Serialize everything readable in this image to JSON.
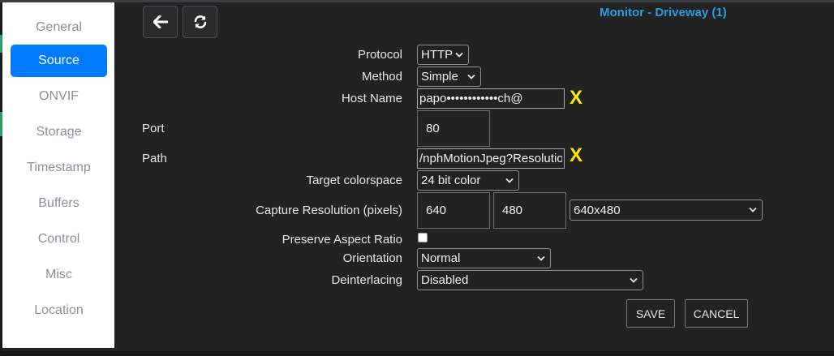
{
  "sidebar": {
    "items": [
      {
        "label": "General",
        "active": false
      },
      {
        "label": "Source",
        "active": true
      },
      {
        "label": "ONVIF",
        "active": false
      },
      {
        "label": "Storage",
        "active": false
      },
      {
        "label": "Timestamp",
        "active": false
      },
      {
        "label": "Buffers",
        "active": false
      },
      {
        "label": "Control",
        "active": false
      },
      {
        "label": "Misc",
        "active": false
      },
      {
        "label": "Location",
        "active": false
      }
    ]
  },
  "toolbar": {
    "back_icon": "arrow-left-icon",
    "refresh_icon": "refresh-icon"
  },
  "header": {
    "title": "Monitor - Driveway (1)"
  },
  "form": {
    "protocol": {
      "label": "Protocol",
      "value": "HTTP"
    },
    "method": {
      "label": "Method",
      "value": "Simple"
    },
    "host_name": {
      "label": "Host Name",
      "value": "papo••••••••••••ch@",
      "marker": "X"
    },
    "port": {
      "label": "Port",
      "value": "80"
    },
    "path": {
      "label": "Path",
      "value": "/nphMotionJpeg?Resolution",
      "marker": "X"
    },
    "target_colorspace": {
      "label": "Target colorspace",
      "value": "24 bit color"
    },
    "capture_resolution": {
      "label": "Capture Resolution (pixels)",
      "width": "640",
      "height": "480",
      "preset": "640x480"
    },
    "preserve_aspect_ratio": {
      "label": "Preserve Aspect Ratio",
      "checked": false
    },
    "orientation": {
      "label": "Orientation",
      "value": "Normal"
    },
    "deinterlacing": {
      "label": "Deinterlacing",
      "value": "Disabled"
    }
  },
  "actions": {
    "save_label": "SAVE",
    "cancel_label": "CANCEL"
  },
  "colors": {
    "accent": "#007bff",
    "title": "#2b9be0",
    "marker": "#ffea00",
    "background": "#222222"
  }
}
